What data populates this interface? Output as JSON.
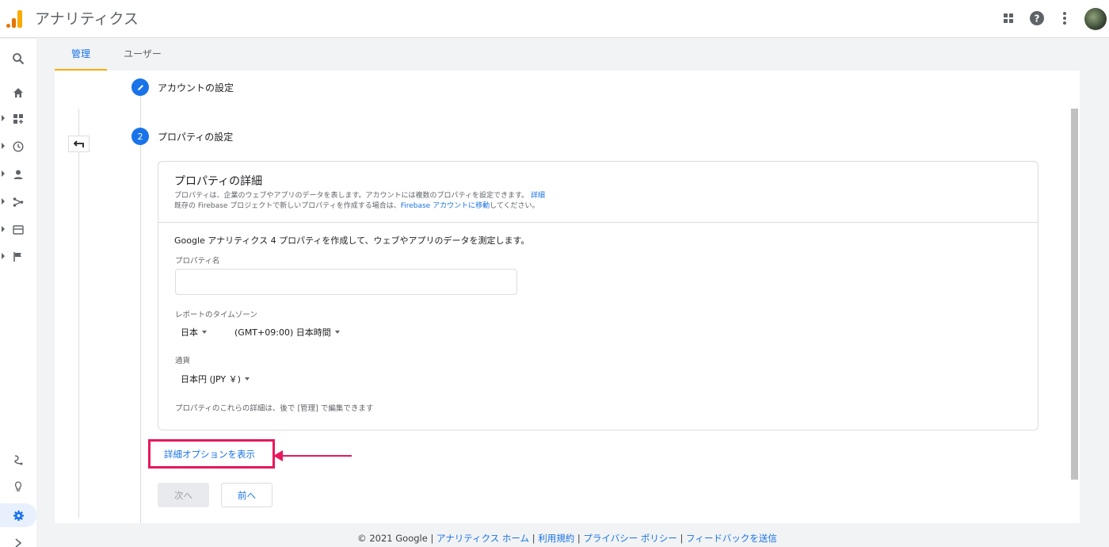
{
  "app": {
    "title": "アナリティクス"
  },
  "colors": {
    "accent": "#1a73e8",
    "highlight": "#e8175d",
    "tab_underline": "#f9ab00"
  },
  "topbar": {
    "icons": [
      "apps-grid-icon",
      "help-icon",
      "more-vert-icon",
      "avatar"
    ]
  },
  "leftnav": {
    "items": [
      "search-icon",
      "home-icon",
      "customization-icon",
      "realtime-icon",
      "audience-icon",
      "acquisition-icon",
      "behavior-icon",
      "conversions-icon"
    ],
    "bottom_items": [
      "attribution-icon",
      "discover-icon",
      "admin-gear-icon",
      "expand-icon"
    ]
  },
  "tabs": [
    {
      "label": "管理",
      "active": true
    },
    {
      "label": "ユーザー",
      "active": false
    }
  ],
  "steps": {
    "step1": {
      "label": "アカウントの設定",
      "icon": "pencil-icon"
    },
    "step2": {
      "label": "プロパティの設定",
      "number": "2"
    }
  },
  "card": {
    "title": "プロパティの詳細",
    "desc1": "プロパティは、企業のウェブやアプリのデータを表します。アカウントには複数のプロパティを設定できます。",
    "desc1_link": "詳細",
    "desc2_pre": "既存の Firebase プロジェクトで新しいプロパティを作成する場合は、",
    "desc2_link": "Firebase アカウントに移動",
    "desc2_post": "してください。",
    "lead": "Google アナリティクス 4 プロパティを作成して、ウェブやアプリのデータを測定します。",
    "property_name_label": "プロパティ名",
    "property_name_value": "",
    "timezone_label": "レポートのタイムゾーン",
    "country": "日本",
    "timezone": "(GMT+09:00) 日本時間",
    "currency_label": "通貨",
    "currency": "日本円 (JPY ￥)",
    "note": "プロパティのこれらの詳細は、後で [管理] で編集できます"
  },
  "advanced_link": "詳細オプションを表示",
  "buttons": {
    "next": "次へ",
    "prev": "前へ"
  },
  "footer": {
    "copyright": "© 2021 Google",
    "links": [
      "アナリティクス ホーム",
      "利用規約",
      "プライバシー ポリシー",
      "フィードバックを送信"
    ],
    "sep": " | "
  }
}
